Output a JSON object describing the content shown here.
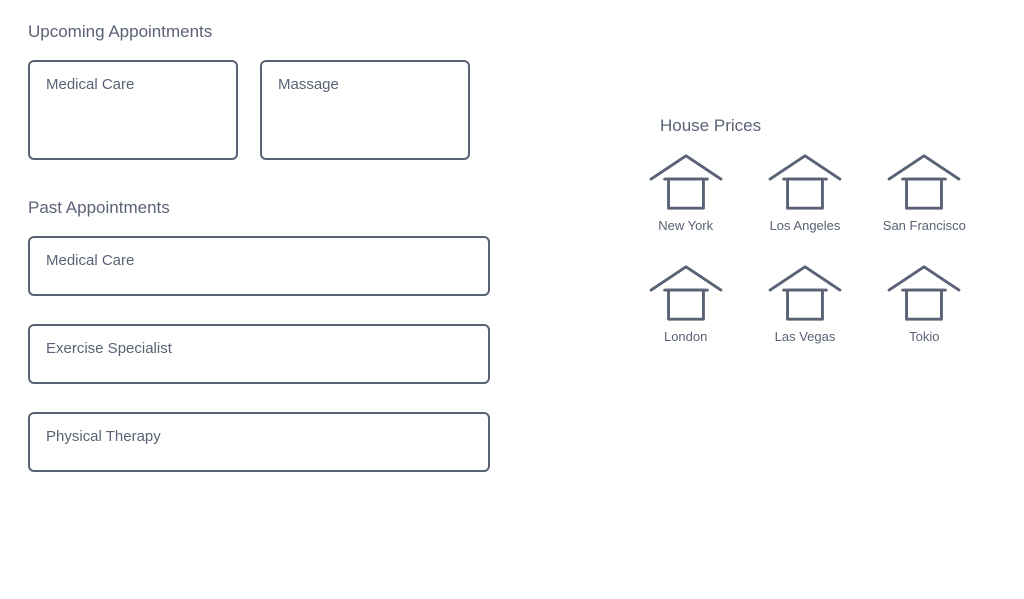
{
  "upcoming": {
    "title": "Upcoming Appointments",
    "items": [
      {
        "label": "Medical Care"
      },
      {
        "label": "Massage"
      }
    ]
  },
  "past": {
    "title": "Past Appointments",
    "items": [
      {
        "label": "Medical Care"
      },
      {
        "label": "Exercise Specialist"
      },
      {
        "label": "Physical Therapy"
      }
    ]
  },
  "house_prices": {
    "title": "House Prices",
    "items": [
      {
        "label": "New York"
      },
      {
        "label": "Los Angeles"
      },
      {
        "label": "San Francisco"
      },
      {
        "label": "London"
      },
      {
        "label": "Las Vegas"
      },
      {
        "label": "Tokio"
      }
    ]
  }
}
